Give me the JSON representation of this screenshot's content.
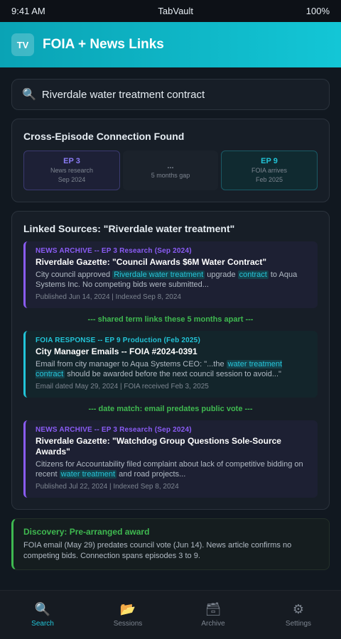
{
  "status_bar": {
    "time": "9:41 AM",
    "app": "TabVault",
    "battery": "100%"
  },
  "header": {
    "logo": "TV",
    "title": "FOIA + News Links"
  },
  "search": {
    "icon": "🔍",
    "query": "Riverdale water treatment contract"
  },
  "connection": {
    "title": "Cross-Episode Connection Found",
    "timeline": [
      {
        "ep": "EP 3",
        "line1": "News research",
        "line2": "Sep 2024"
      },
      {
        "ep": "...",
        "line1": "5 months gap",
        "line2": ""
      },
      {
        "ep": "EP 9",
        "line1": "FOIA arrives",
        "line2": "Feb 2025"
      }
    ]
  },
  "sources": {
    "title": "Linked Sources: \"Riverdale water treatment\"",
    "items": [
      {
        "label": "NEWS ARCHIVE -- EP 3 Research (Sep 2024)",
        "title": "Riverdale Gazette: \"Council Awards $6M Water Contract\"",
        "body": [
          "City council approved ",
          "Riverdale water treatment",
          " upgrade ",
          "contract",
          " to Aqua Systems Inc. No competing bids were submitted..."
        ],
        "meta": "Published Jun 14, 2024 | Indexed Sep 8, 2024"
      },
      {
        "label": "FOIA RESPONSE -- EP 9 Production (Feb 2025)",
        "title": "City Manager Emails -- FOIA #2024-0391",
        "body": [
          "Email from city manager to Aqua Systems CEO: \"...the ",
          "water treatment contract",
          " should be awarded before the next council session to avoid...\""
        ],
        "meta": "Email dated May 29, 2024 | FOIA received Feb 3, 2025"
      },
      {
        "label": "NEWS ARCHIVE -- EP 3 Research (Sep 2024)",
        "title": "Riverdale Gazette: \"Watchdog Group Questions Sole-Source Awards\"",
        "body": [
          "Citizens for Accountability filed complaint about lack of competitive bidding on recent ",
          "water treatment",
          " and road projects..."
        ],
        "meta": "Published Jul 22, 2024 | Indexed Sep 8, 2024"
      }
    ],
    "link_notes": [
      "--- shared term links these 5 months apart ---",
      "--- date match: email predates public vote ---"
    ]
  },
  "discovery": {
    "title": "Discovery: Pre-arranged award",
    "body": "FOIA email (May 29) predates council vote (Jun 14). News article confirms no competing bids. Connection spans episodes 3 to 9."
  },
  "tabs": [
    {
      "icon": "🔍",
      "label": "Search"
    },
    {
      "icon": "📂",
      "label": "Sessions"
    },
    {
      "icon": "🗃",
      "label": "Archive"
    },
    {
      "icon": "⚙",
      "label": "Settings"
    }
  ],
  "colors": {
    "accent": "#22c5d8",
    "news": "#8b5cf6",
    "link": "#3fb950",
    "background": "#111820"
  }
}
